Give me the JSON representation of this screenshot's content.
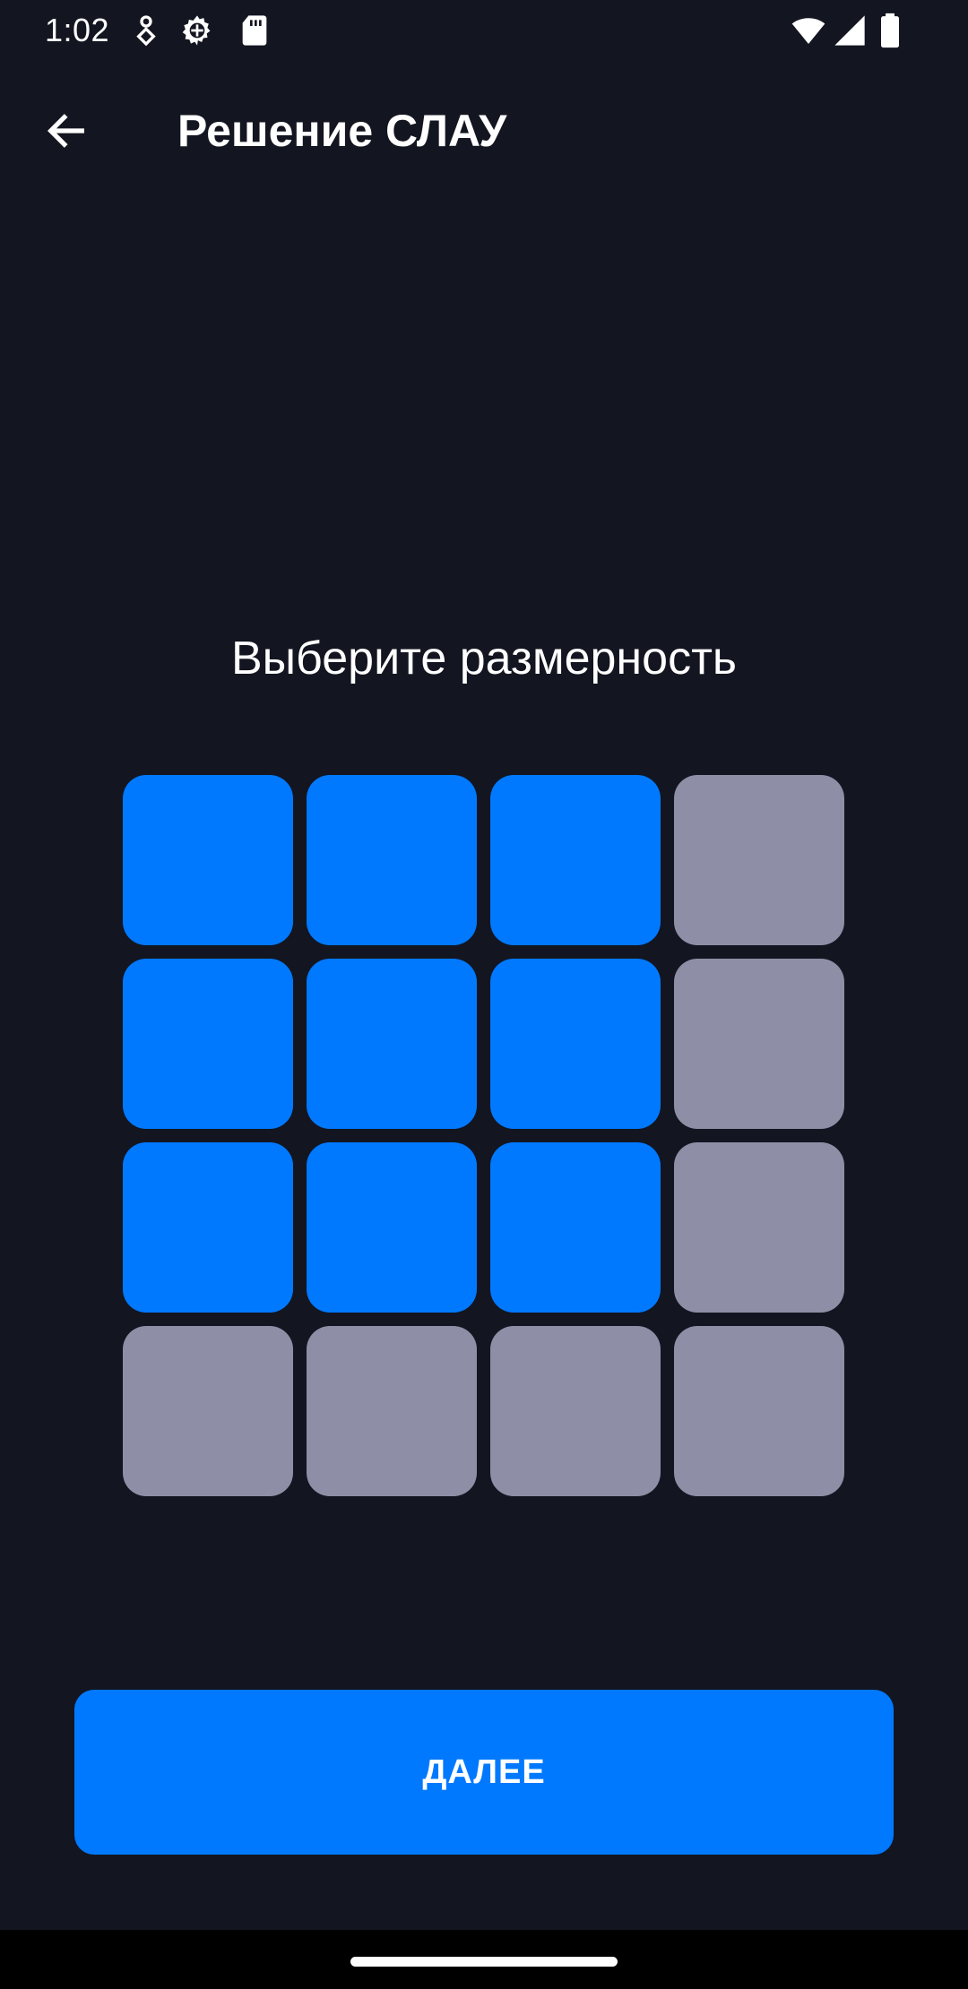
{
  "status_bar": {
    "time": "1:02",
    "left_icons": [
      "pin-heart-icon",
      "settings-gear-icon",
      "sd-card-icon"
    ],
    "right_icons": [
      "wifi-icon",
      "cellular-signal-icon",
      "battery-icon"
    ]
  },
  "app_bar": {
    "back_icon": "arrow-back-icon",
    "title": "Решение СЛАУ"
  },
  "main": {
    "prompt": "Выберите размерность",
    "grid": {
      "rows": 4,
      "cols": 4,
      "selected_rows": 3,
      "selected_cols": 3,
      "active_color": "#0079FF",
      "inactive_color": "#8E8EA6"
    },
    "next_label": "ДАЛЕЕ"
  },
  "colors": {
    "background": "#131520",
    "accent": "#0079FF",
    "text": "#FFFFFF"
  }
}
